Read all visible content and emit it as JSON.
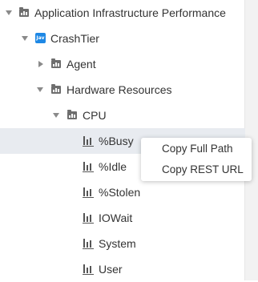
{
  "tree": {
    "root": {
      "label": "Application Infrastructure Performance"
    },
    "tier": {
      "label": "CrashTier",
      "icon": "java-icon",
      "icon_text": "Jav"
    },
    "agent": {
      "label": "Agent"
    },
    "hardware": {
      "label": "Hardware Resources"
    },
    "cpu": {
      "label": "CPU"
    },
    "metrics": [
      {
        "label": "%Busy",
        "selected": true
      },
      {
        "label": "%Idle"
      },
      {
        "label": "%Stolen"
      },
      {
        "label": "IOWait"
      },
      {
        "label": "System"
      },
      {
        "label": "User"
      }
    ]
  },
  "context_menu": {
    "items": [
      {
        "label": "Copy Full Path"
      },
      {
        "label": "Copy REST URL"
      }
    ]
  },
  "colors": {
    "selection": "#e8ebf0",
    "java_badge": "#1e88e5",
    "icon_gray": "#6e6e6e"
  }
}
